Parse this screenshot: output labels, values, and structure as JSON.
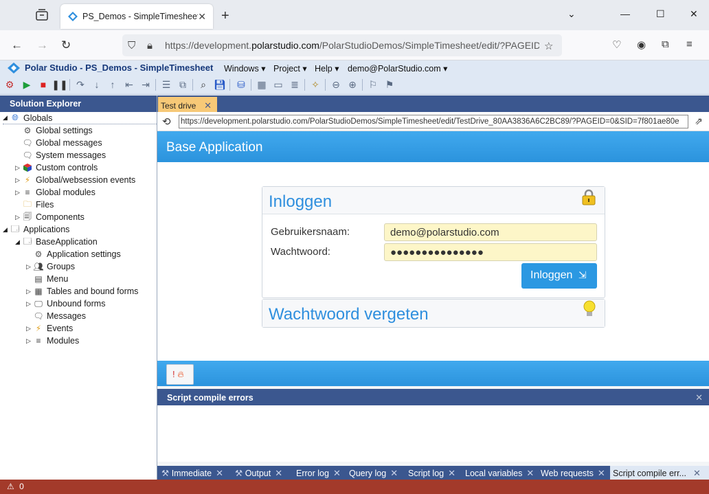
{
  "browser": {
    "tab_title": "PS_Demos - SimpleTimesheet -",
    "url_prefix": "https://development.",
    "url_domain": "polarstudio.com",
    "url_suffix": "/PolarStudioDemos/SimpleTimesheet/edit/?PAGEID="
  },
  "app": {
    "title": "Polar Studio - PS_Demos - SimpleTimesheet",
    "menus": [
      "Windows",
      "Project",
      "Help",
      "demo@PolarStudio.com"
    ]
  },
  "explorer": {
    "title": "Solution Explorer",
    "items": [
      {
        "label": "Globals",
        "icon": "globe-icon"
      },
      {
        "label": "Global settings",
        "icon": "settings-gears-icon"
      },
      {
        "label": "Global messages",
        "icon": "message-icon"
      },
      {
        "label": "System messages",
        "icon": "message-icon"
      },
      {
        "label": "Custom controls",
        "icon": "cube-icon"
      },
      {
        "label": "Global/websession events",
        "icon": "lightning-icon"
      },
      {
        "label": "Global modules",
        "icon": "module-lines-icon"
      },
      {
        "label": "Files",
        "icon": "folder-icon"
      },
      {
        "label": "Components",
        "icon": "components-icon"
      },
      {
        "label": "Applications",
        "icon": "applications-icon"
      },
      {
        "label": "BaseApplication",
        "icon": "window-icon"
      },
      {
        "label": "Application settings",
        "icon": "settings-gears-icon"
      },
      {
        "label": "Groups",
        "icon": "group-icon"
      },
      {
        "label": "Menu",
        "icon": "menu-icon"
      },
      {
        "label": "Tables and bound forms",
        "icon": "table-icon"
      },
      {
        "label": "Unbound forms",
        "icon": "monitor-icon"
      },
      {
        "label": "Messages",
        "icon": "message-icon"
      },
      {
        "label": "Events",
        "icon": "lightning-icon"
      },
      {
        "label": "Modules",
        "icon": "module-lines-icon"
      }
    ]
  },
  "doc": {
    "tab_label": "Test drive",
    "inner_url": "https://development.polarstudio.com/PolarStudioDemos/SimpleTimesheet/edit/TestDrive_80AA3836A6C2BC89/?PAGEID=0&SID=7f801ae80e"
  },
  "content": {
    "app_header": "Base Application",
    "login": {
      "title": "Inloggen",
      "username_label": "Gebruikersnaam:",
      "username_value": "demo@polarstudio.com",
      "password_label": "Wachtwoord:",
      "password_value": "●●●●●●●●●●●●●●●",
      "button": "Inloggen"
    },
    "forgot": {
      "title": "Wachtwoord vergeten"
    },
    "error_button": "!"
  },
  "compile": {
    "title": "Script compile errors"
  },
  "bottom_tabs": [
    {
      "label": "Immediate"
    },
    {
      "label": "Output"
    },
    {
      "label": "Error log"
    },
    {
      "label": "Query log"
    },
    {
      "label": "Script log"
    },
    {
      "label": "Local variables"
    },
    {
      "label": "Web requests"
    },
    {
      "label": "Script compile err..."
    }
  ],
  "status": {
    "count": "0"
  }
}
